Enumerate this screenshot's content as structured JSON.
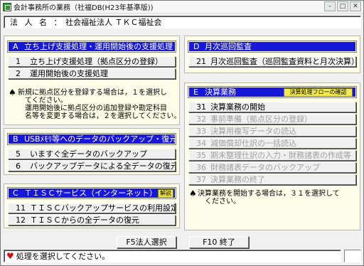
{
  "window": {
    "title": "会計事務所の業務（社福DB(H23年基準版))"
  },
  "header": {
    "label": "法 人 名 ：",
    "value": "社会福祉法人 ＴＫＣ福祉会"
  },
  "sections": {
    "A": {
      "letter": "A",
      "title": "立ち上げ支援処理・運用開始後の支援処理",
      "items": [
        {
          "num": "1",
          "label": "立ち上げ支援処理（拠点区分の登録）"
        },
        {
          "num": "2",
          "label": "運用開始後の支援処理"
        }
      ],
      "note": "新規に拠点区分を登録する場合は，１を選択し\n　てください。\n　運用開始後に拠点区分の追加登録や勘定科目\n　名等を変更する場合は，２を選択してください。"
    },
    "B": {
      "letter": "B",
      "title": "USBﾒﾓﾘ等へのデータのバックアップ・復元",
      "items": [
        {
          "num": "5",
          "label": "いますぐ全データのバックアップ"
        },
        {
          "num": "6",
          "label": "バックアップデータによる全データの復元"
        }
      ]
    },
    "C": {
      "letter": "C",
      "title": "ＴＩＳＣサービス（インターネット）",
      "badge": "解説",
      "items": [
        {
          "num": "11",
          "label": "ＴＩＳＣバックアップサービスの利用設定"
        },
        {
          "num": "12",
          "label": "ＴＩＳＣからの全データの復元"
        }
      ]
    },
    "D": {
      "letter": "D",
      "title": "月次巡回監査",
      "items": [
        {
          "num": "21",
          "label": "月次巡回監査（巡回監査資料と月次決算）"
        }
      ]
    },
    "E": {
      "letter": "E",
      "title": "決算業務",
      "badge": "決算処理フローの確認",
      "items": [
        {
          "num": "31",
          "label": "決算業務の開始"
        },
        {
          "num": "32",
          "label": "事前準備（拠点区分の登録）"
        },
        {
          "num": "33",
          "label": "決算用複写データの読込"
        },
        {
          "num": "34",
          "label": "減価償却仕訳の一括読込"
        },
        {
          "num": "35",
          "label": "期末整理仕訳の入力・財務諸表の作成等"
        },
        {
          "num": "36",
          "label": "財務諸表データのバックアップ"
        },
        {
          "num": "37",
          "label": "決算業務の終了"
        }
      ],
      "note": "決算業務を開始する場合は，３１を選択して\n　ください。"
    }
  },
  "footer": {
    "f5": "F5法人選択",
    "f10": "F10 終了"
  },
  "status": {
    "message": "処理を選択してください。"
  }
}
